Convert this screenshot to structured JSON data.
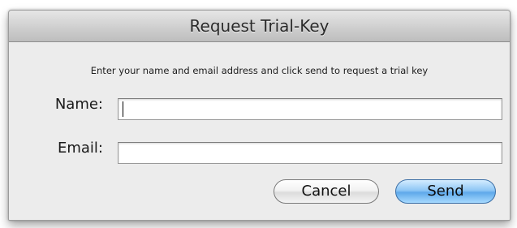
{
  "dialog": {
    "title": "Request Trial-Key",
    "instructions": "Enter your name and email address and click send to request a trial key",
    "name_label": "Name:",
    "name_value": "",
    "email_label": "Email:",
    "email_value": "",
    "cancel_label": "Cancel",
    "send_label": "Send"
  },
  "colors": {
    "default_button": "#6fb3ee",
    "window_background": "#ececec"
  }
}
